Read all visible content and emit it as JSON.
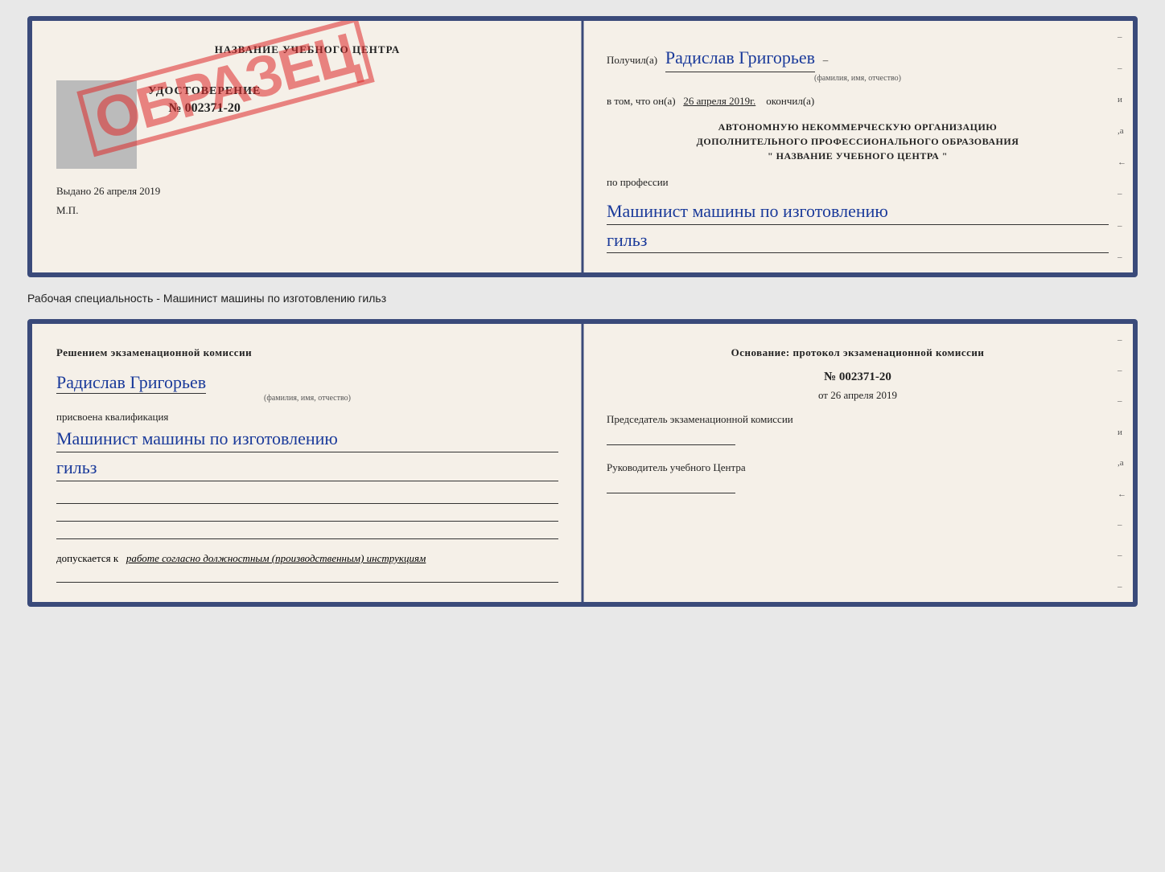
{
  "top_card": {
    "left": {
      "center_title": "НАЗВАНИЕ УЧЕБНОГО ЦЕНТРА",
      "cert_label": "УДОСТОВЕРЕНИЕ",
      "cert_number": "№ 002371-20",
      "issued_label": "Выдано",
      "issued_date": "26 апреля 2019",
      "mp_label": "М.П.",
      "stamp_text": "ОБРАЗЕЦ"
    },
    "right": {
      "received_label": "Получил(а)",
      "person_name": "Радислав Григорьев",
      "name_subtext": "(фамилия, имя, отчество)",
      "in_that_label": "в том, что он(а)",
      "completion_date": "26 апреля 2019г.",
      "finished_label": "окончил(а)",
      "org_line1": "АВТОНОМНУЮ НЕКОММЕРЧЕСКУЮ ОРГАНИЗАЦИЮ",
      "org_line2": "ДОПОЛНИТЕЛЬНОГО ПРОФЕССИОНАЛЬНОГО ОБРАЗОВАНИЯ",
      "org_name": "\"  НАЗВАНИЕ УЧЕБНОГО ЦЕНТРА  \"",
      "profession_label": "по профессии",
      "profession_line1": "Машинист машины по изготовлению",
      "profession_line2": "гильз"
    }
  },
  "caption": "Рабочая специальность - Машинист машины по изготовлению гильз",
  "bottom_card": {
    "left": {
      "komissia_title": "Решением  экзаменационной  комиссии",
      "person_name": "Радислав Григорьев",
      "name_subtext": "(фамилия, имя, отчество)",
      "assigned_label": "присвоена квалификация",
      "qualification_line1": "Машинист  машины  по  изготовлению",
      "qualification_line2": "гильз",
      "допускается_label": "допускается к",
      "допускается_text": "работе согласно должностным (производственным) инструкциям"
    },
    "right": {
      "osnov_title": "Основание: протокол экзаменационной  комиссии",
      "number": "№  002371-20",
      "date_prefix": "от",
      "date": "26 апреля 2019",
      "chairman_label": "Председатель экзаменационной комиссии",
      "director_label": "Руководитель учебного Центра"
    }
  }
}
